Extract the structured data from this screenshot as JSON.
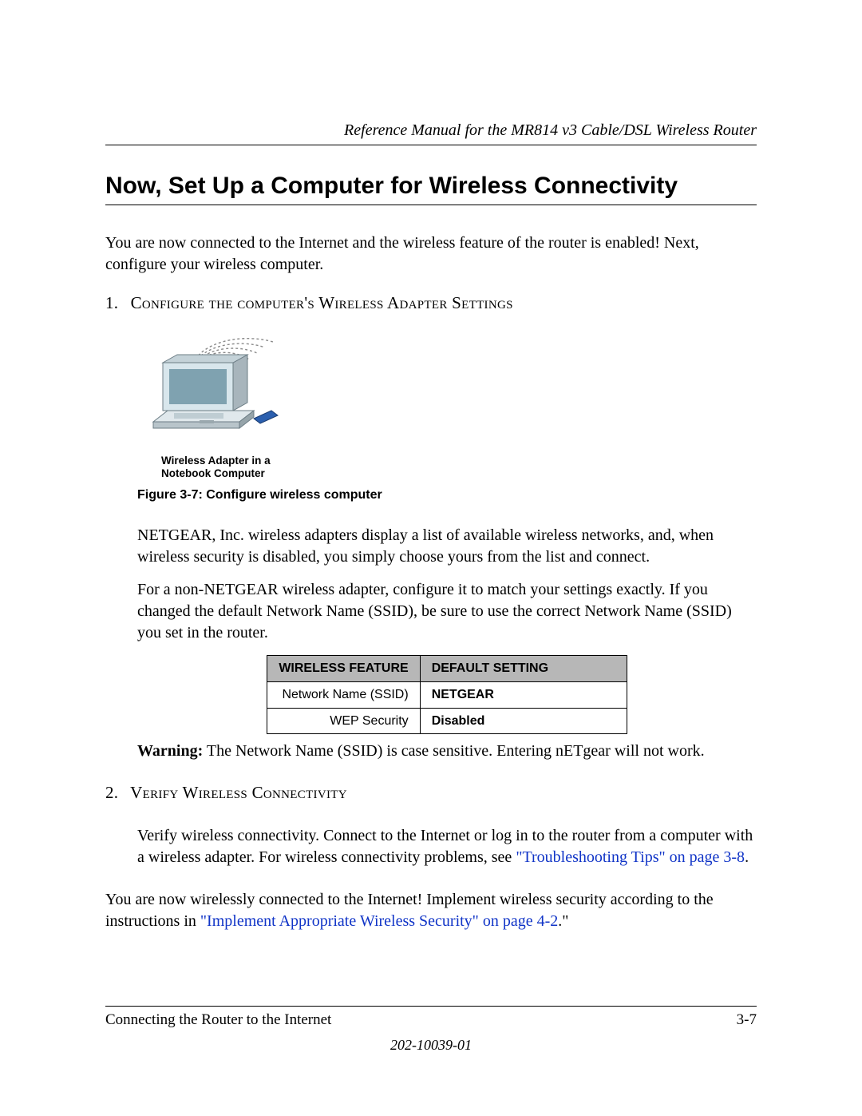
{
  "header": {
    "running_title": "Reference Manual for the MR814 v3 Cable/DSL Wireless Router"
  },
  "title": "Now, Set Up a Computer for Wireless Connectivity",
  "intro": "You are now connected to the Internet and the wireless feature of the router is enabled! Next, configure your wireless computer.",
  "steps": [
    {
      "num": "1.",
      "heading": "Configure the computer's Wireless Adapter Settings",
      "image_caption_line1": "Wireless Adapter in a",
      "image_caption_line2": "Notebook Computer",
      "figure_label": "Figure 3-7:  Configure wireless computer",
      "para1": "NETGEAR, Inc. wireless adapters display a list of available wireless networks, and, when wireless security is disabled, you simply choose yours from the list and connect.",
      "para2": "For a non-NETGEAR wireless adapter, configure it to match your settings exactly. If you changed the default Network Name (SSID), be sure to use the correct Network Name (SSID) you set in the router.",
      "table": {
        "col1": "Wireless Feature",
        "col2": "Default Setting",
        "rows": [
          {
            "feature": "Network Name (SSID)",
            "value": "NETGEAR"
          },
          {
            "feature": "WEP Security",
            "value": "Disabled"
          }
        ]
      },
      "warning_bold": "Warning:",
      "warning_text": " The Network Name (SSID) is case sensitive. Entering nETgear will not work."
    },
    {
      "num": "2.",
      "heading": "Verify Wireless Connectivity",
      "para1_a": "Verify wireless connectivity. Connect to the Internet or log in to the router from a computer with a wireless adapter. For wireless connectivity problems, see ",
      "para1_link": "\"Troubleshooting Tips\" on page 3-8",
      "para1_b": "."
    }
  ],
  "closing_a": "You are now wirelessly connected to the Internet! Implement wireless security according to the instructions in ",
  "closing_link": "\"Implement Appropriate Wireless Security\" on page 4-2",
  "closing_b": ".\"",
  "footer": {
    "section": "Connecting the Router to the Internet",
    "page": "3-7",
    "docnum": "202-10039-01"
  }
}
